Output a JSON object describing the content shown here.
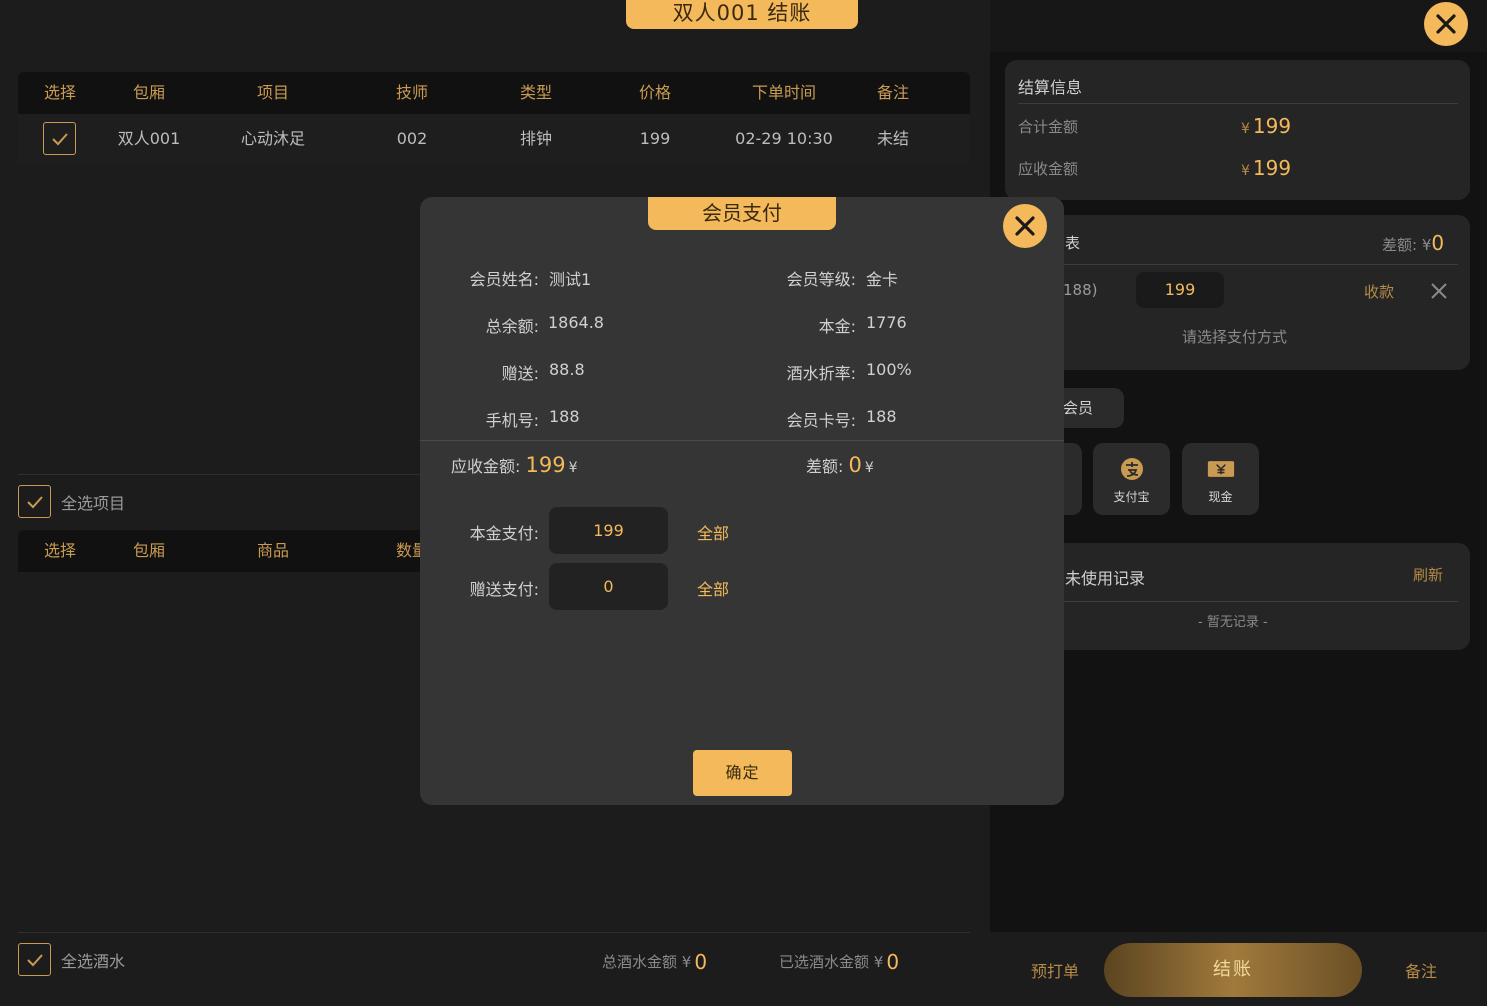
{
  "header": {
    "title": "双人001 结账"
  },
  "orders_table": {
    "columns": [
      "选择",
      "包厢",
      "项目",
      "技师",
      "类型",
      "价格",
      "下单时间",
      "备注"
    ],
    "rows": [
      {
        "room": "双人001",
        "item": "心动沐足",
        "tech": "002",
        "type": "排钟",
        "price": "199",
        "time": "02-29 10:30",
        "note": "未结"
      }
    ]
  },
  "select_all_items": "全选项目",
  "drinks_table": {
    "columns": [
      "选择",
      "包厢",
      "商品",
      "数量"
    ]
  },
  "select_all_drinks": "全选酒水",
  "drinks_totals": {
    "total_label": "总酒水金额 ¥",
    "total_value": "0",
    "selected_label": "已选酒水金额 ¥",
    "selected_value": "0"
  },
  "settlement": {
    "title": "结算信息",
    "total_label": "合计金额",
    "total_value": "199",
    "due_label": "应收金额",
    "due_value": "199",
    "currency": "¥"
  },
  "payment_list": {
    "title_fragment": "表",
    "diff_label": "差额: ¥",
    "diff_value": "0",
    "entry_fragment": "188)",
    "entry_amount": "199",
    "collect_label": "收款",
    "hint": "请选择支付方式"
  },
  "methods": {
    "member_fragment": "会员",
    "alipay": "支付宝",
    "cash": "现金"
  },
  "unused_records": {
    "title_fragment": "未使用记录",
    "refresh": "刷新",
    "empty": "- 暂无记录 -"
  },
  "footer": {
    "pre_print": "预打单",
    "checkout": "结账",
    "remark": "备注"
  },
  "modal": {
    "title": "会员支付",
    "name_label": "会员姓名:",
    "name_value": "测试1",
    "level_label": "会员等级:",
    "level_value": "金卡",
    "balance_label": "总余额:",
    "balance_value": "1864.8",
    "principal_label": "本金:",
    "principal_value": "1776",
    "bonus_label": "赠送:",
    "bonus_value": "88.8",
    "drink_discount_label": "酒水折率:",
    "drink_discount_value": "100%",
    "phone_label": "手机号:",
    "phone_value": "188",
    "card_label": "会员卡号:",
    "card_value": "188",
    "due_label": "应收金额:",
    "due_value": "199",
    "diff_label": "差额:",
    "diff_value": "0",
    "currency": "¥",
    "principal_pay_label": "本金支付:",
    "principal_pay_value": "199",
    "bonus_pay_label": "赠送支付:",
    "bonus_pay_value": "0",
    "all_label": "全部",
    "confirm": "确定"
  },
  "colors": {
    "accent": "#f4b95a",
    "panel": "#353535",
    "background": "#171717"
  }
}
